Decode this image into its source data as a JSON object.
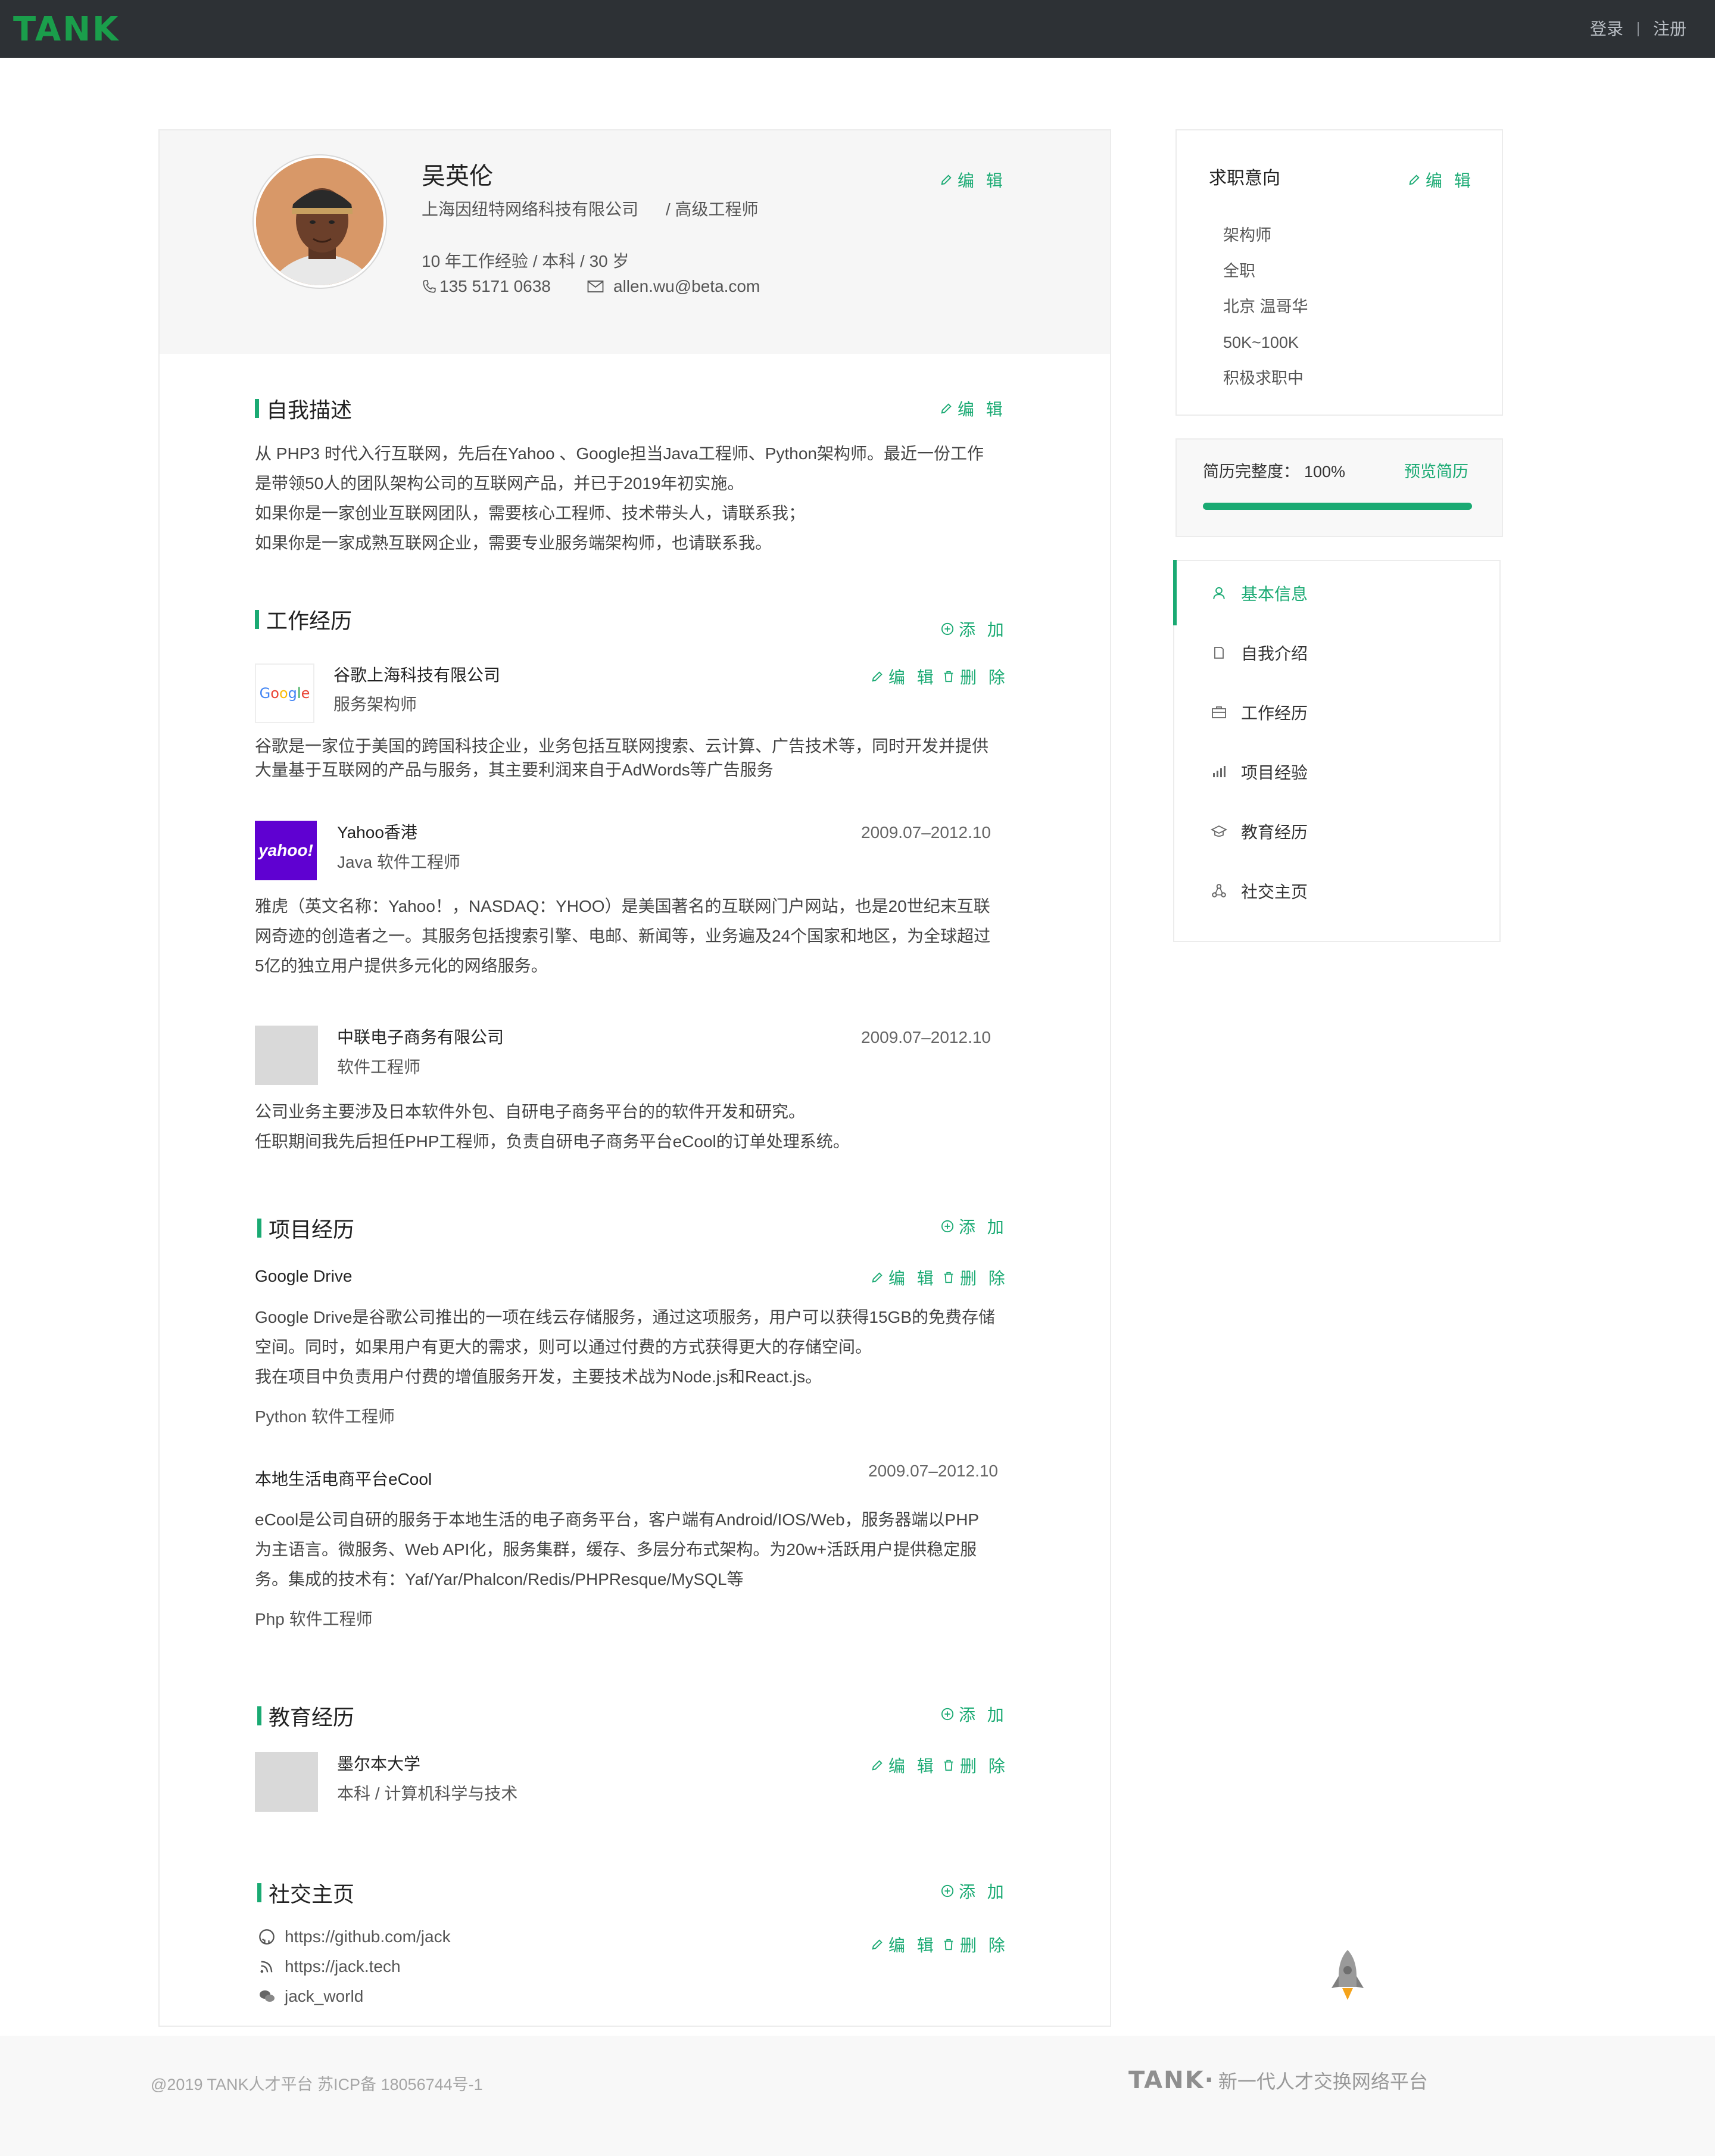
{
  "header": {
    "logo": "TANK",
    "login": "登录",
    "register": "注册"
  },
  "profile": {
    "name": "吴英伦",
    "company": "上海因纽特网络科技有限公司",
    "position": "/ 高级工程师",
    "meta": "10 年工作经验 / 本科 / 30 岁",
    "phone": "135 5171 0638",
    "email": "allen.wu@beta.com",
    "edit": "编 辑"
  },
  "self_desc": {
    "title": "自我描述",
    "edit": "编 辑",
    "lines": [
      "从 PHP3 时代入行互联网，先后在Yahoo 、Google担当Java工程师、Python架构师。最近一份工作",
      "是带领50人的团队架构公司的互联网产品，并已于2019年初实施。",
      "如果你是一家创业互联网团队，需要核心工程师、技术带头人，请联系我；",
      "如果你是一家成熟互联网企业，需要专业服务端架构师，也请联系我。"
    ]
  },
  "work": {
    "title": "工作经历",
    "add": "添 加",
    "edit": "编 辑",
    "delete": "删 除",
    "items": [
      {
        "logo_text": "Google",
        "company": "谷歌上海科技有限公司",
        "role": "服务架构师",
        "date": "",
        "desc": [
          "谷歌是一家位于美国的跨国科技企业，业务包括互联网搜索、云计算、广告技术等，同时开发并提供",
          "大量基于互联网的产品与服务，其主要利润来自于AdWords等广告服务"
        ]
      },
      {
        "logo_text": "yahoo!",
        "company": "Yahoo香港",
        "role": "Java 软件工程师",
        "date": "2009.07–2012.10",
        "desc": [
          "雅虎（英文名称：Yahoo！，NASDAQ：YHOO）是美国著名的互联网门户网站，也是20世纪末互联",
          "网奇迹的创造者之一。其服务包括搜索引擎、电邮、新闻等，业务遍及24个国家和地区，为全球超过",
          "5亿的独立用户提供多元化的网络服务。"
        ]
      },
      {
        "logo_text": "",
        "company": "中联电子商务有限公司",
        "role": "软件工程师",
        "date": "2009.07–2012.10",
        "desc": [
          "公司业务主要涉及日本软件外包、自研电子商务平台的的软件开发和研究。",
          "任职期间我先后担任PHP工程师，负责自研电子商务平台eCool的订单处理系统。"
        ]
      }
    ]
  },
  "projects": {
    "title": "项目经历",
    "add": "添 加",
    "edit": "编 辑",
    "delete": "删 除",
    "items": [
      {
        "name": "Google Drive",
        "date": "",
        "desc": [
          "Google Drive是谷歌公司推出的一项在线云存储服务，通过这项服务，用户可以获得15GB的免费存储",
          "空间。同时，如果用户有更大的需求，则可以通过付费的方式获得更大的存储空间。",
          "我在项目中负责用户付费的增值服务开发，主要技术战为Node.js和React.js。"
        ],
        "role": "Python 软件工程师"
      },
      {
        "name": "本地生活电商平台eCool",
        "date": "2009.07–2012.10",
        "desc": [
          "eCool是公司自研的服务于本地生活的电子商务平台，客户端有Android/IOS/Web，服务器端以PHP",
          "为主语言。微服务、Web API化，服务集群，缓存、多层分布式架构。为20w+活跃用户提供稳定服",
          "务。集成的技术有：Yaf/Yar/Phalcon/Redis/PHPResque/MySQL等"
        ],
        "role": "Php 软件工程师"
      }
    ]
  },
  "education": {
    "title": "教育经历",
    "add": "添 加",
    "edit": "编 辑",
    "delete": "删 除",
    "school": "墨尔本大学",
    "degree": "本科 / 计算机科学与技术"
  },
  "social": {
    "title": "社交主页",
    "add": "添 加",
    "edit": "编 辑",
    "delete": "删 除",
    "links": [
      "https://github.com/jack",
      "https://jack.tech",
      "jack_world"
    ]
  },
  "intent": {
    "title": "求职意向",
    "edit": "编 辑",
    "items": [
      "架构师",
      "全职",
      "北京 温哥华",
      "50K~100K",
      "积极求职中"
    ]
  },
  "completeness": {
    "label": "简历完整度：",
    "value": "100%",
    "progress": 1.0,
    "preview": "预览简历"
  },
  "sidenav": {
    "items": [
      {
        "label": "基本信息",
        "icon": "user-icon",
        "active": true
      },
      {
        "label": "自我介绍",
        "icon": "document-icon",
        "active": false
      },
      {
        "label": "工作经历",
        "icon": "briefcase-icon",
        "active": false
      },
      {
        "label": "项目经验",
        "icon": "bar-chart-icon",
        "active": false
      },
      {
        "label": "教育经历",
        "icon": "graduation-cap-icon",
        "active": false
      },
      {
        "label": "社交主页",
        "icon": "share-icon",
        "active": false
      }
    ]
  },
  "footer": {
    "copyright": "@2019 TANK人才平台 苏ICP备 18056744号-1",
    "brand": "TANK·",
    "slogan": "新一代人才交换网络平台"
  },
  "colors": {
    "accent": "#1aaa73",
    "topbar": "#2d3135",
    "logo": "#1a9e4b"
  }
}
